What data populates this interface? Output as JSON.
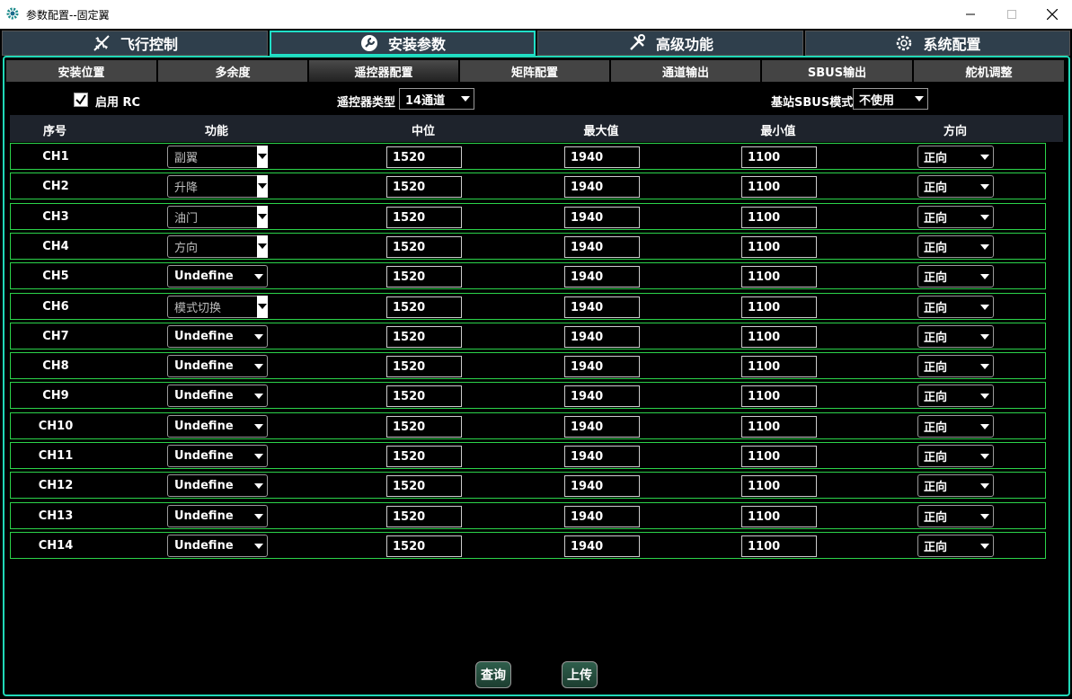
{
  "window": {
    "title": "参数配置--固定翼"
  },
  "main_tabs": [
    {
      "label": "飞行控制",
      "icon": "airplane-icon"
    },
    {
      "label": "安装参数",
      "icon": "wrench-icon"
    },
    {
      "label": "高级功能",
      "icon": "tools-icon"
    },
    {
      "label": "系统配置",
      "icon": "gear-icon"
    }
  ],
  "active_main_tab": "安装参数",
  "sub_tabs": [
    "安装位置",
    "多余度",
    "遥控器配置",
    "矩阵配置",
    "通道输出",
    "SBUS输出",
    "舵机调整"
  ],
  "active_sub_tab": "遥控器配置",
  "options": {
    "enable_rc_label": "启用 RC",
    "enable_rc_checked": true,
    "rc_type_label": "遥控器类型",
    "rc_type_value": "14通道",
    "sbus_mode_label": "基站SBUS模式",
    "sbus_mode_value": "不使用"
  },
  "table": {
    "headers": [
      "序号",
      "功能",
      "中位",
      "最大值",
      "最小值",
      "方向"
    ],
    "rows": [
      {
        "ch": "CH1",
        "func": "副翼",
        "locked": true,
        "mid": "1520",
        "max": "1940",
        "min": "1100",
        "dir": "正向"
      },
      {
        "ch": "CH2",
        "func": "升降",
        "locked": true,
        "mid": "1520",
        "max": "1940",
        "min": "1100",
        "dir": "正向"
      },
      {
        "ch": "CH3",
        "func": "油门",
        "locked": true,
        "mid": "1520",
        "max": "1940",
        "min": "1100",
        "dir": "正向"
      },
      {
        "ch": "CH4",
        "func": "方向",
        "locked": true,
        "mid": "1520",
        "max": "1940",
        "min": "1100",
        "dir": "正向"
      },
      {
        "ch": "CH5",
        "func": "Undefine",
        "locked": false,
        "mid": "1520",
        "max": "1940",
        "min": "1100",
        "dir": "正向"
      },
      {
        "ch": "CH6",
        "func": "模式切换",
        "locked": true,
        "mid": "1520",
        "max": "1940",
        "min": "1100",
        "dir": "正向"
      },
      {
        "ch": "CH7",
        "func": "Undefine",
        "locked": false,
        "mid": "1520",
        "max": "1940",
        "min": "1100",
        "dir": "正向"
      },
      {
        "ch": "CH8",
        "func": "Undefine",
        "locked": false,
        "mid": "1520",
        "max": "1940",
        "min": "1100",
        "dir": "正向"
      },
      {
        "ch": "CH9",
        "func": "Undefine",
        "locked": false,
        "mid": "1520",
        "max": "1940",
        "min": "1100",
        "dir": "正向"
      },
      {
        "ch": "CH10",
        "func": "Undefine",
        "locked": false,
        "mid": "1520",
        "max": "1940",
        "min": "1100",
        "dir": "正向"
      },
      {
        "ch": "CH11",
        "func": "Undefine",
        "locked": false,
        "mid": "1520",
        "max": "1940",
        "min": "1100",
        "dir": "正向"
      },
      {
        "ch": "CH12",
        "func": "Undefine",
        "locked": false,
        "mid": "1520",
        "max": "1940",
        "min": "1100",
        "dir": "正向"
      },
      {
        "ch": "CH13",
        "func": "Undefine",
        "locked": false,
        "mid": "1520",
        "max": "1940",
        "min": "1100",
        "dir": "正向"
      },
      {
        "ch": "CH14",
        "func": "Undefine",
        "locked": false,
        "mid": "1520",
        "max": "1940",
        "min": "1100",
        "dir": "正向"
      }
    ]
  },
  "buttons": {
    "query": "查询",
    "upload": "上传"
  },
  "colors": {
    "accent": "#20e0c8",
    "row_border": "#2bd34a",
    "tab_bg": "#2f3f4c",
    "button_bg": "#2f5e4c"
  }
}
